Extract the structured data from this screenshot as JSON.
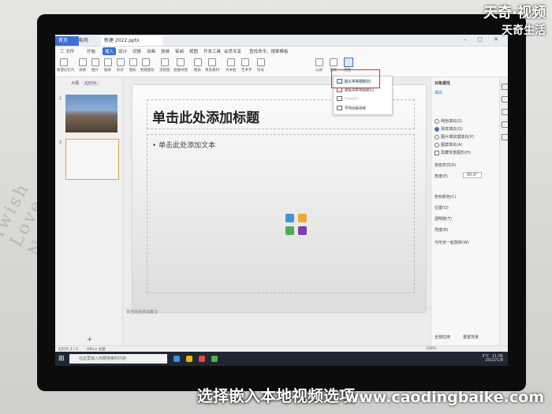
{
  "watermark": {
    "line1": "天奇·视频",
    "line2": "天奇生活"
  },
  "caption": "选择嵌入本地视频选项",
  "site": "www.caodingbaike.com",
  "app": {
    "tabs": [
      {
        "label": "首页"
      },
      {
        "label": "稻壳"
      },
      {
        "label": "新建 2022.pptx"
      }
    ],
    "menu": [
      "三 文件",
      "开始",
      "插入",
      "设计",
      "切换",
      "动画",
      "放映",
      "审阅",
      "视图",
      "开发工具",
      "会员专享",
      "查找命令、搜索模板"
    ],
    "menu_active": "插入",
    "ribbon_labels": [
      "新建幻灯片",
      "表格",
      "图片",
      "截屏",
      "形状",
      "图标",
      "智能图形",
      "流程图",
      "思维导图",
      "图表",
      "更多素材",
      "文本框",
      "艺术字",
      "符号",
      "公式",
      "音频",
      "视频"
    ],
    "video_menu": {
      "items": [
        "嵌入本地视频(E)",
        "链接到本地视频(L)",
        "Flash(F)",
        "开场动画视频"
      ],
      "selected_index": 0
    },
    "left_panel": {
      "tab_outline": "大纲",
      "tab_slides": "幻灯片",
      "slide_numbers": [
        "1",
        "2"
      ],
      "add": "+"
    },
    "slide": {
      "title": "单击此处添加标题",
      "body": "• 单击此处添加文本"
    },
    "notes": "单击此处添加备注",
    "right_panel": {
      "header": "对象属性",
      "tab": "填充",
      "radios": [
        "纯色填充(S)",
        "渐变填充(G)",
        "图片或纹理填充(P)",
        "图案填充(A)",
        "隐藏背景图形(H)"
      ],
      "labels": [
        "渐变样式(R)",
        "角度(E)",
        "色标颜色(C)",
        "位置(O)",
        "透明度(T)",
        "亮度(B)",
        "与形状一起旋转(W)",
        "全部应用",
        "重置背景"
      ],
      "angle": "90.0°"
    },
    "status": {
      "slide": "幻灯片 2 / 2",
      "theme": "Office 主题",
      "zoom": "100%"
    },
    "taskbar": {
      "search_placeholder": "在这里输入你要搜索的内容",
      "temp": "3°C",
      "time": "11:06",
      "date": "2022/1/8"
    }
  }
}
